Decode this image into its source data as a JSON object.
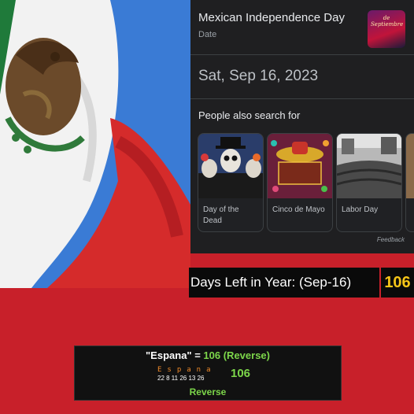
{
  "knowledge_panel": {
    "title": "Mexican Independence Day",
    "subtitle": "Date",
    "thumbnail_caption": "de Septiembre",
    "date": "Sat, Sep 16, 2023",
    "also_search_heading": "People also search for",
    "cards": [
      {
        "label": "Day of the Dead"
      },
      {
        "label": "Cinco de Mayo"
      },
      {
        "label": "Labor Day"
      }
    ],
    "feedback": "Feedback"
  },
  "days_left": {
    "label": "Days Left in Year: (Sep-16)",
    "value": "106"
  },
  "cipher": {
    "word": "\"Espana\"",
    "eq": " = ",
    "result": "106 (Reverse)",
    "letters": "Espana",
    "numbers": "22  8  11  26  13  26",
    "total": "106",
    "method": "Reverse"
  },
  "colors": {
    "background_red": "#c8202a",
    "panel_dark": "#1f1f21",
    "days_value_yellow": "#f5c518",
    "cipher_green": "#7cd64a",
    "cipher_orange": "#f08a2a"
  }
}
